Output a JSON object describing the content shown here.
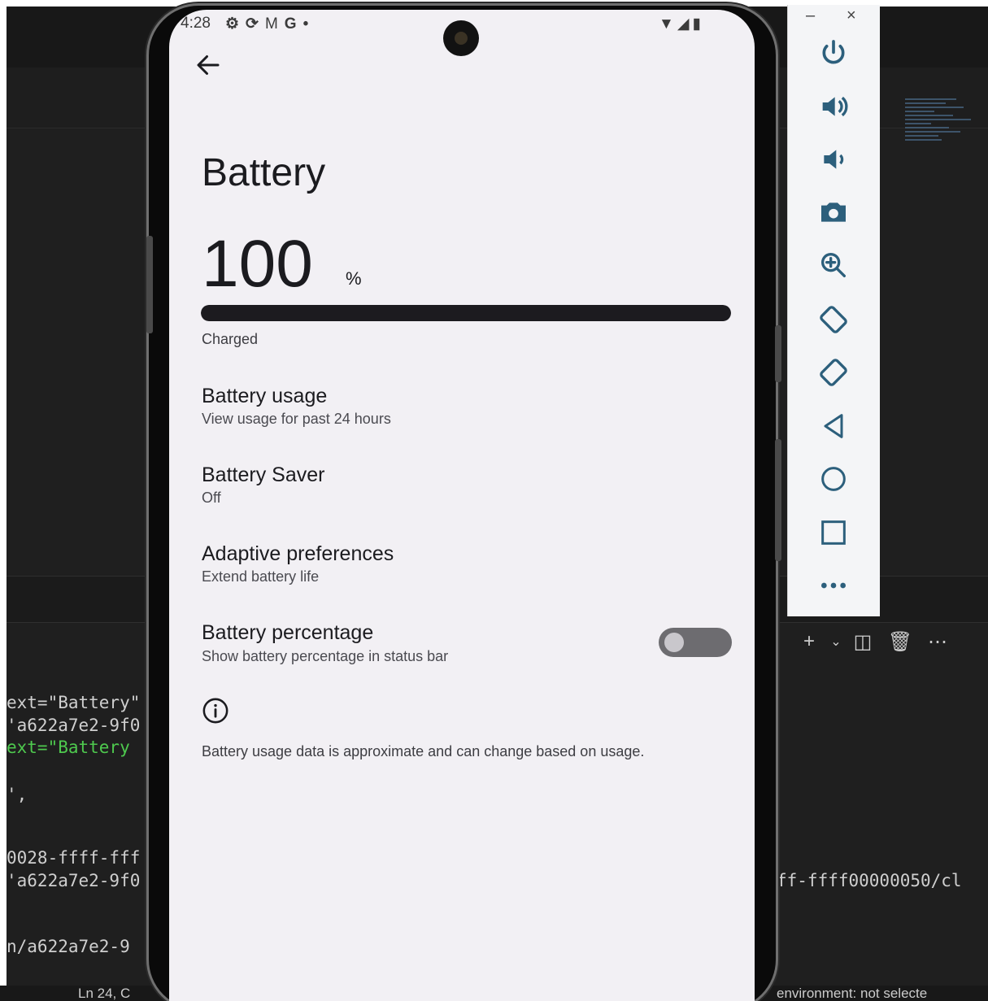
{
  "background_editor": {
    "code_lines": [
      {
        "text": "ext=\"Battery\"",
        "color": "#cfcfcf"
      },
      {
        "text": "'a622a7e2-9f0",
        "color": "#cfcfcf"
      },
      {
        "text": "ext=\"Battery",
        "color": "#4ec94e"
      },
      {
        "text": "',",
        "color": "#cfcfcf"
      },
      {
        "text": "0028-ffff-fff",
        "color": "#cfcfcf"
      },
      {
        "text": "'a622a7e2-9f0",
        "color": "#cfcfcf"
      },
      {
        "text": "n/a622a7e2-9",
        "color": "#cfcfcf"
      }
    ],
    "right_code_line": "ff-ffff00000050/cl",
    "status_left": "Ln 24, C",
    "status_right": "environment: not selecte",
    "panel_icons": [
      "plus-icon",
      "chevron-down-icon",
      "split-icon",
      "trash-icon",
      "more-icon"
    ]
  },
  "phone": {
    "status_bar": {
      "time": "4:28",
      "left_icons": [
        "gear-icon",
        "sync-icon",
        "gmail-icon",
        "google-icon",
        "dot-icon"
      ],
      "right_icons": [
        "wifi-icon",
        "signal-icon",
        "battery-icon"
      ]
    },
    "title": "Battery",
    "level": {
      "number": "100",
      "unit": "%",
      "fill_fraction": 1.0,
      "status": "Charged"
    },
    "preferences": [
      {
        "title": "Battery usage",
        "summary": "View usage for past 24 hours"
      },
      {
        "title": "Battery Saver",
        "summary": "Off"
      },
      {
        "title": "Adaptive preferences",
        "summary": "Extend battery life"
      },
      {
        "title": "Battery percentage",
        "summary": "Show battery percentage in status bar",
        "toggle": false
      }
    ],
    "footer": "Battery usage data is approximate and can change based on usage."
  },
  "emulator_toolbar": {
    "window_controls": [
      "–",
      "×"
    ],
    "buttons": [
      "power-icon",
      "volume-up-icon",
      "volume-down-icon",
      "screenshot-icon",
      "zoom-icon",
      "rotate-left-icon",
      "rotate-right-icon",
      "back-icon",
      "home-icon",
      "overview-icon",
      "more-icon"
    ]
  },
  "colors": {
    "screen_bg": "#f2f0f4",
    "text_primary": "#1b1b1f",
    "editor_bg": "#1f1f1f",
    "code_green": "#4ec94e"
  }
}
